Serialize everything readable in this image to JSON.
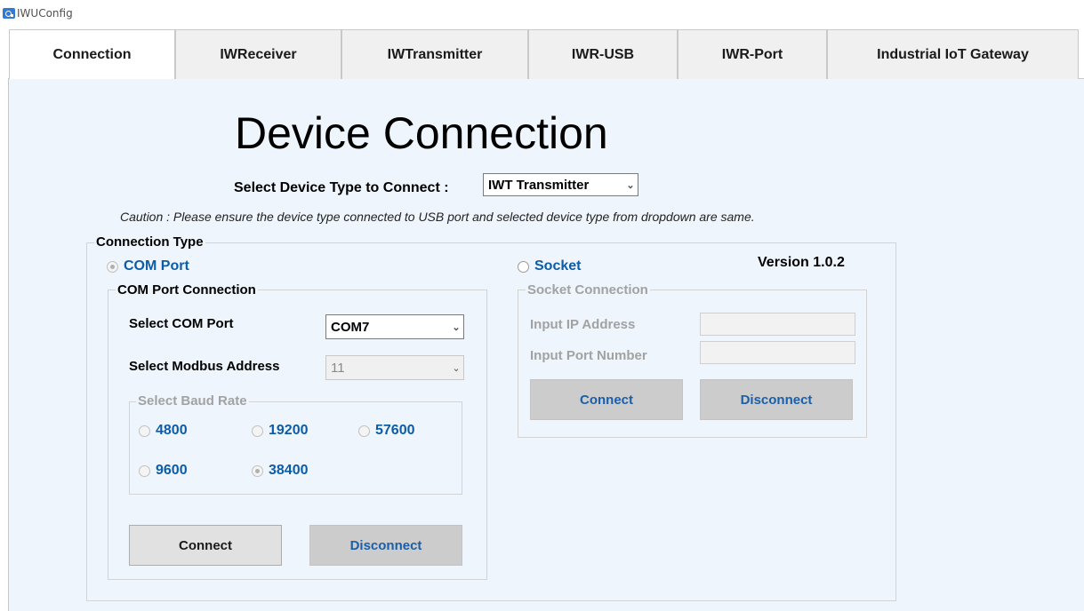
{
  "window": {
    "title": "IWUConfig"
  },
  "tabs": [
    {
      "label": "Connection",
      "active": true
    },
    {
      "label": "IWReceiver",
      "active": false
    },
    {
      "label": "IWTransmitter",
      "active": false
    },
    {
      "label": "IWR-USB",
      "active": false
    },
    {
      "label": "IWR-Port",
      "active": false
    },
    {
      "label": "Industrial IoT Gateway",
      "active": false
    }
  ],
  "page": {
    "heading": "Device Connection",
    "device_type_label": "Select Device Type to Connect :",
    "device_type_value": "IWT Transmitter",
    "caution": "Caution : Please ensure the device type connected to USB port and selected device type from dropdown are same.",
    "version": "Version 1.0.2"
  },
  "connection_type": {
    "legend": "Connection Type",
    "com_port_option": {
      "label": "COM Port",
      "selected": true
    },
    "socket_option": {
      "label": "Socket",
      "selected": false
    }
  },
  "com_port_connection": {
    "legend": "COM Port Connection",
    "com_port_label": "Select COM Port",
    "com_port_value": "COM7",
    "modbus_label": "Select Modbus Address",
    "modbus_value": "11",
    "baud_legend": "Select Baud Rate",
    "baud_rates": [
      {
        "label": "4800",
        "selected": false
      },
      {
        "label": "19200",
        "selected": false
      },
      {
        "label": "57600",
        "selected": false
      },
      {
        "label": "9600",
        "selected": false
      },
      {
        "label": "38400",
        "selected": true
      }
    ],
    "connect_label": "Connect",
    "disconnect_label": "Disconnect"
  },
  "socket_connection": {
    "legend": "Socket Connection",
    "ip_label": "Input IP Address",
    "ip_value": "",
    "port_label": "Input Port Number",
    "port_value": "",
    "connect_label": "Connect",
    "disconnect_label": "Disconnect"
  },
  "colors": {
    "page_background": "#eef5fc",
    "radio_text": "#0d5ca8",
    "disabled_text": "#a2a2a2"
  },
  "icons": [
    "app-icon",
    "chevron-down-icon"
  ]
}
